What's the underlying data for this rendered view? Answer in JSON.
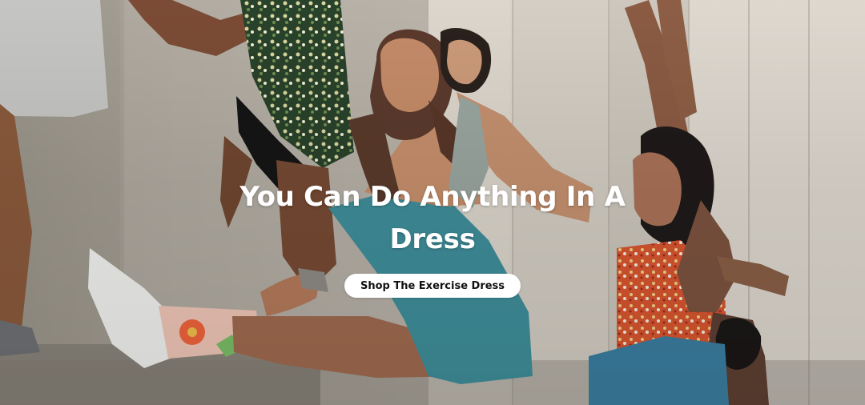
{
  "hero": {
    "headline": "You Can Do Anything In A Dress",
    "cta_label": "Shop The Exercise Dress"
  },
  "colors": {
    "headline_text": "#ffffff",
    "button_background": "#ffffff",
    "button_text": "#111111",
    "teal_dress": "#3f8f9b",
    "floral_dress": "#d9562f",
    "stone_wall": "#cfc8bd"
  },
  "icons": []
}
